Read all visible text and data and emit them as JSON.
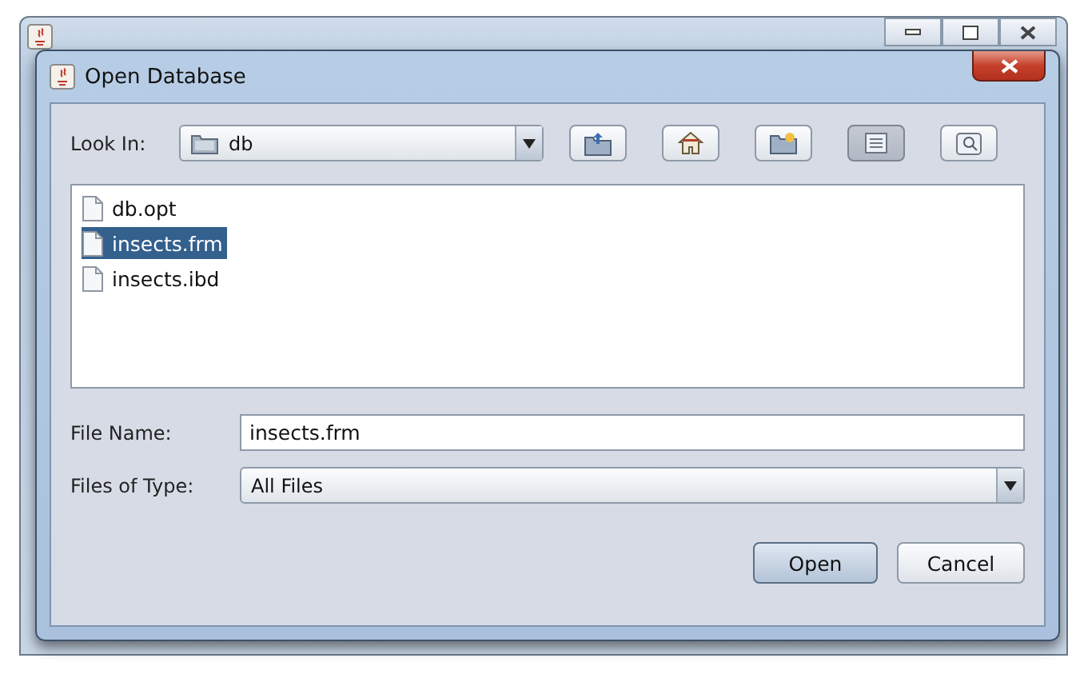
{
  "dialog": {
    "title": "Open Database"
  },
  "look_in": {
    "label": "Look In:",
    "value": "db"
  },
  "toolbar": [
    {
      "kind": "up",
      "selected": false
    },
    {
      "kind": "home",
      "selected": false
    },
    {
      "kind": "newfolder",
      "selected": false
    },
    {
      "kind": "list",
      "selected": true
    },
    {
      "kind": "details",
      "selected": false
    }
  ],
  "files": [
    {
      "name": "db.opt",
      "selected": false
    },
    {
      "name": "insects.frm",
      "selected": true
    },
    {
      "name": "insects.ibd",
      "selected": false
    }
  ],
  "file_name": {
    "label": "File Name:",
    "value": "insects.frm"
  },
  "files_of_type": {
    "label": "Files of Type:",
    "value": "All Files"
  },
  "buttons": [
    {
      "label": "Open",
      "kind": "default"
    },
    {
      "label": "Cancel",
      "kind": "normal"
    }
  ]
}
